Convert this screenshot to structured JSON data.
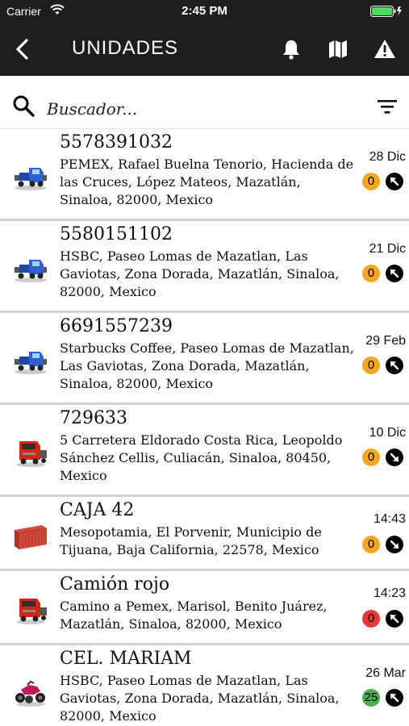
{
  "status_bar": {
    "carrier": "Carrier",
    "time": "2:45 PM",
    "battery_color": "#4cd964"
  },
  "header": {
    "title": "UNIDADES",
    "back_icon": "chevron-left-icon",
    "icons": [
      "bell-icon",
      "map-icon",
      "warning-icon"
    ]
  },
  "search": {
    "placeholder": "Buscador...",
    "value": ""
  },
  "units": [
    {
      "name": "5578391032",
      "address": "PEMEX, Rafael Buelna Tenorio, Hacienda de las Cruces, López Mateos, Mazatlán, Sinaloa, 82000, Mexico",
      "date": "28 Dic",
      "count": "0",
      "count_color": "#f5a623",
      "vehicle_icon": "truck-blue-icon",
      "direction": "up-left"
    },
    {
      "name": "5580151102",
      "address": "HSBC, Paseo Lomas de Mazatlan, Las Gaviotas, Zona Dorada, Mazatlán, Sinaloa, 82000, Mexico",
      "date": "21 Dic",
      "count": "0",
      "count_color": "#f5a623",
      "vehicle_icon": "truck-blue-icon",
      "direction": "up-left"
    },
    {
      "name": "6691557239",
      "address": "Starbucks Coffee, Paseo Lomas de Mazatlan, Las Gaviotas, Zona Dorada, Mazatlán, Sinaloa, 82000, Mexico",
      "date": "29 Feb",
      "count": "0",
      "count_color": "#f5a623",
      "vehicle_icon": "truck-blue-icon",
      "direction": "up-left"
    },
    {
      "name": "729633",
      "address": "5 Carretera Eldorado Costa Rica, Leopoldo Sánchez Cellis, Culiacán, Sinaloa, 80450, Mexico",
      "date": "10 Dic",
      "count": "0",
      "count_color": "#f5a623",
      "vehicle_icon": "truck-red-icon",
      "direction": "down-right"
    },
    {
      "name": "CAJA 42",
      "address": "Mesopotamia, El Porvenir, Municipio de Tijuana, Baja California, 22578, Mexico",
      "date": "14:43",
      "count": "0",
      "count_color": "#f5a623",
      "vehicle_icon": "container-icon",
      "direction": "down-right"
    },
    {
      "name": "Camión rojo",
      "address": "Camino a Pemex, Marisol, Benito Juárez, Mazatlán, Sinaloa, 82000, Mexico",
      "date": "14:23",
      "count": "0",
      "count_color": "#e53935",
      "vehicle_icon": "truck-red-icon",
      "direction": "up-left"
    },
    {
      "name": "CEL. MARIAM",
      "address": "HSBC, Paseo Lomas de Mazatlan, Las Gaviotas, Zona Dorada, Mazatlán, Sinaloa, 82000, Mexico",
      "date": "26 Mar",
      "count": "25",
      "count_color": "#4caf50",
      "vehicle_icon": "atv-icon",
      "direction": "up-left"
    }
  ]
}
